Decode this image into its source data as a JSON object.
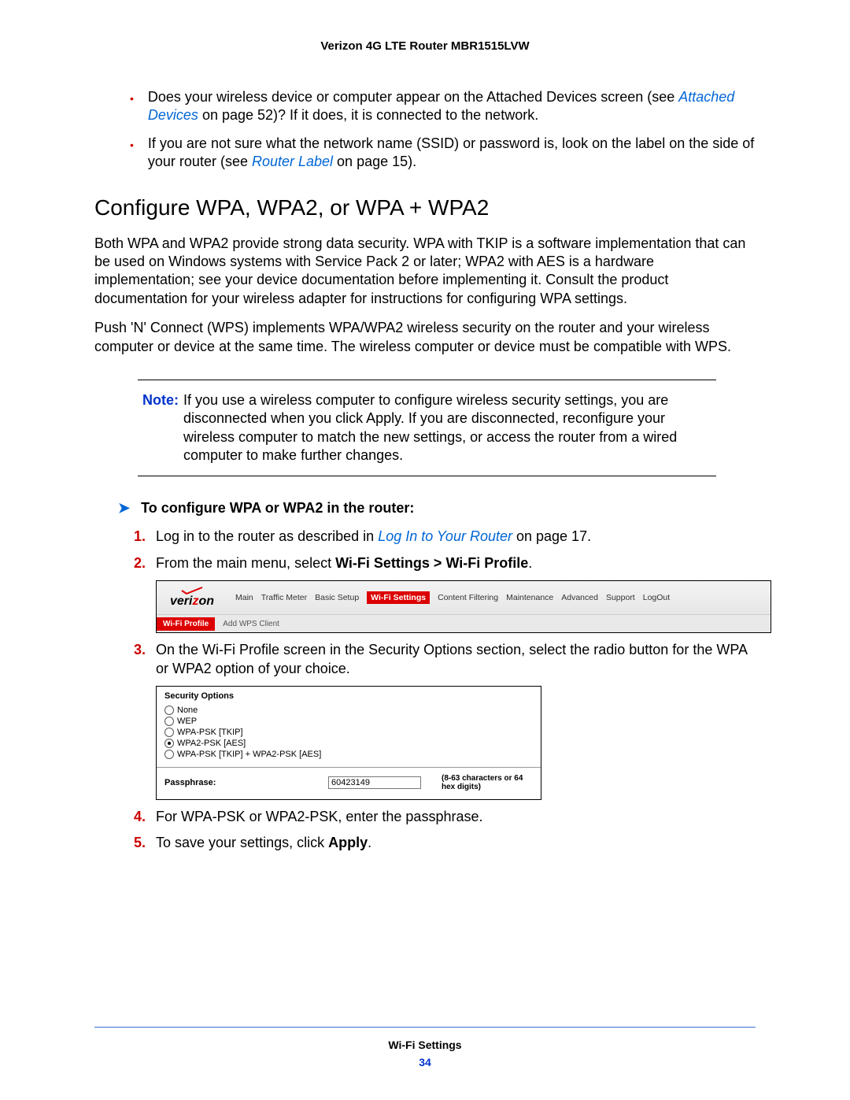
{
  "header": "Verizon 4G LTE Router MBR1515LVW",
  "bullets": [
    {
      "pre": "Does your wireless device or computer appear on the Attached Devices screen (see ",
      "link": "Attached Devices",
      "post": " on page 52)? If it does, it is connected to the network."
    },
    {
      "pre": "If you are not sure what the network name (SSID) or password is, look on the label on the side of your router (see ",
      "link": "Router Label",
      "post": " on page 15)."
    }
  ],
  "h2": "Configure WPA, WPA2, or WPA + WPA2",
  "para1": "Both WPA and WPA2 provide strong data security. WPA with TKIP is a software implementation that can be used on Windows systems with Service Pack 2 or later; WPA2 with AES is a hardware implementation; see your device documentation before implementing it. Consult the product documentation for your wireless adapter for instructions for configuring WPA settings.",
  "para2": "Push 'N' Connect (WPS) implements WPA/WPA2 wireless security on the router and your wireless computer or device at the same time. The wireless computer or device must be compatible with WPS.",
  "note_label": "Note:",
  "note_text": "If you use a wireless computer to configure wireless security settings, you are disconnected when you click Apply. If you are disconnected, reconfigure your wireless computer to match the new settings, or access the router from a wired computer to make further changes.",
  "proc_title": "To configure WPA or WPA2 in the router:",
  "steps": {
    "s1_pre": "Log in to the router as described in ",
    "s1_link": "Log In to Your Router",
    "s1_post": " on page 17.",
    "s2_pre": "From the main menu, select ",
    "s2_bold": "Wi-Fi Settings > Wi-Fi Profile",
    "s2_post": ".",
    "s3": "On the Wi-Fi Profile screen in the Security Options section, select the radio button for the WPA or WPA2 option of your choice.",
    "s4": "For WPA-PSK or WPA2-PSK, enter the passphrase.",
    "s5_pre": "To save your settings, click ",
    "s5_bold": "Apply",
    "s5_post": "."
  },
  "nav": {
    "logo": "verizon",
    "tabs": [
      "Main",
      "Traffic Meter",
      "Basic Setup",
      "Wi-Fi Settings",
      "Content Filtering",
      "Maintenance",
      "Advanced",
      "Support",
      "LogOut"
    ],
    "active_tab": "Wi-Fi Settings",
    "subtabs": [
      "Wi-Fi Profile",
      "Add WPS Client"
    ],
    "active_sub": "Wi-Fi Profile"
  },
  "sec": {
    "title": "Security Options",
    "options": [
      "None",
      "WEP",
      "WPA-PSK [TKIP]",
      "WPA2-PSK [AES]",
      "WPA-PSK [TKIP] + WPA2-PSK [AES]"
    ],
    "selected": "WPA2-PSK [AES]",
    "pass_label": "Passphrase:",
    "pass_value": "60423149",
    "hint": "(8-63 characters or 64 hex digits)"
  },
  "footer": {
    "title": "Wi-Fi Settings",
    "page": "34"
  }
}
